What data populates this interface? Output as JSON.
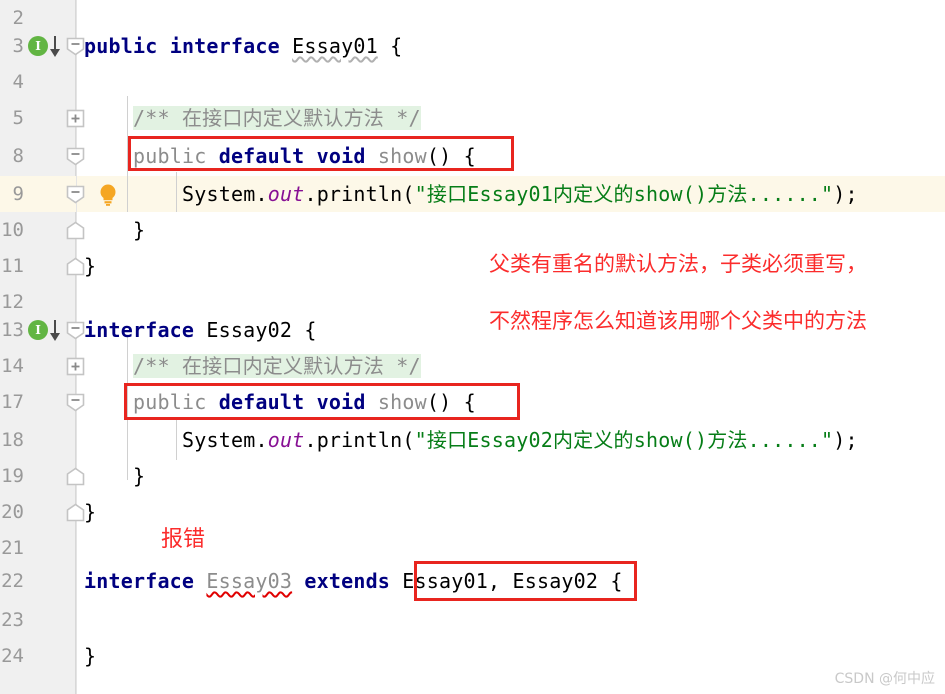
{
  "editor": {
    "language": "java",
    "theme": "IntelliJ Light",
    "colors": {
      "gutter_bg": "#f0f0f0",
      "editor_bg": "#ffffff",
      "current_line_bg": "#fdf8e8",
      "keyword": "#000080",
      "string": "#067d17",
      "comment_fg": "#8c8c8c",
      "comment_bg": "#e2f2e2",
      "static_field": "#871094",
      "dimmed": "#8c8c8c",
      "annotation_red": "#fb2c2c",
      "box_red": "#e8251f",
      "interface_marker": "#62b543",
      "bulb": "#f5a623"
    },
    "lines": [
      {
        "num": "2",
        "indent": 0,
        "text": ""
      },
      {
        "num": "3",
        "indent": 0,
        "text": "public interface Essay01 {"
      },
      {
        "num": "4",
        "indent": 0,
        "text": ""
      },
      {
        "num": "5",
        "indent": 1,
        "text": "/** 在接口内定义默认方法 */"
      },
      {
        "num": "8",
        "indent": 1,
        "text": "public default void show() {"
      },
      {
        "num": "9",
        "indent": 2,
        "text": "System.out.println(\"接口Essay01内定义的show()方法......\");"
      },
      {
        "num": "10",
        "indent": 1,
        "text": "}"
      },
      {
        "num": "11",
        "indent": 0,
        "text": "}"
      },
      {
        "num": "12",
        "indent": 0,
        "text": ""
      },
      {
        "num": "13",
        "indent": 0,
        "text": "interface Essay02 {"
      },
      {
        "num": "14",
        "indent": 1,
        "text": "/** 在接口内定义默认方法 */"
      },
      {
        "num": "17",
        "indent": 1,
        "text": "public default void show() {"
      },
      {
        "num": "18",
        "indent": 2,
        "text": "System.out.println(\"接口Essay02内定义的show()方法......\");"
      },
      {
        "num": "19",
        "indent": 1,
        "text": "}"
      },
      {
        "num": "20",
        "indent": 0,
        "text": "}"
      },
      {
        "num": "21",
        "indent": 0,
        "text": ""
      },
      {
        "num": "22",
        "indent": 0,
        "text": "interface Essay03 extends Essay01, Essay02 {"
      },
      {
        "num": "23",
        "indent": 0,
        "text": ""
      },
      {
        "num": "24",
        "indent": 0,
        "text": "}"
      }
    ],
    "tokens": {
      "kw_public": "public",
      "kw_interface": "interface",
      "kw_default": "default",
      "kw_void": "void",
      "kw_extends": "extends",
      "name_essay01": "Essay01",
      "name_essay02": "Essay02",
      "name_essay03": "Essay03",
      "name_show": "show",
      "brace_open": "{",
      "brace_close": "}",
      "paren_empty": "()",
      "comment_text": "/** 在接口内定义默认方法 */",
      "sysout_system": "System",
      "sysout_dot": ".",
      "sysout_out": "out",
      "sysout_println": "println",
      "string_essay01": "\"接口Essay01内定义的show()方法......\"",
      "string_essay02": "\"接口Essay02内定义的show()方法......\"",
      "stmt_end": ");",
      "comma_sep": ", "
    },
    "gutter_icons": {
      "interface_marker_letter": "I",
      "interface_marker_name": "interface-marker-icon",
      "implemented_arrow_name": "implemented-by-arrow-icon",
      "fold_expanded_name": "fold-collapse-icon",
      "fold_collapsed_name": "fold-expand-icon",
      "fold_end_name": "fold-end-icon",
      "bulb_name": "intention-bulb-icon"
    }
  },
  "annotations": {
    "note_line1": "父类有重名的默认方法，子类必须重写，",
    "note_line2": "不然程序怎么知道该用哪个父类中的方法",
    "note_error": "报错",
    "boxes": [
      {
        "label": "essay01-show-signature-box"
      },
      {
        "label": "essay02-show-signature-box"
      },
      {
        "label": "extends-list-box"
      }
    ]
  },
  "watermark": {
    "text": "CSDN @何中应"
  }
}
